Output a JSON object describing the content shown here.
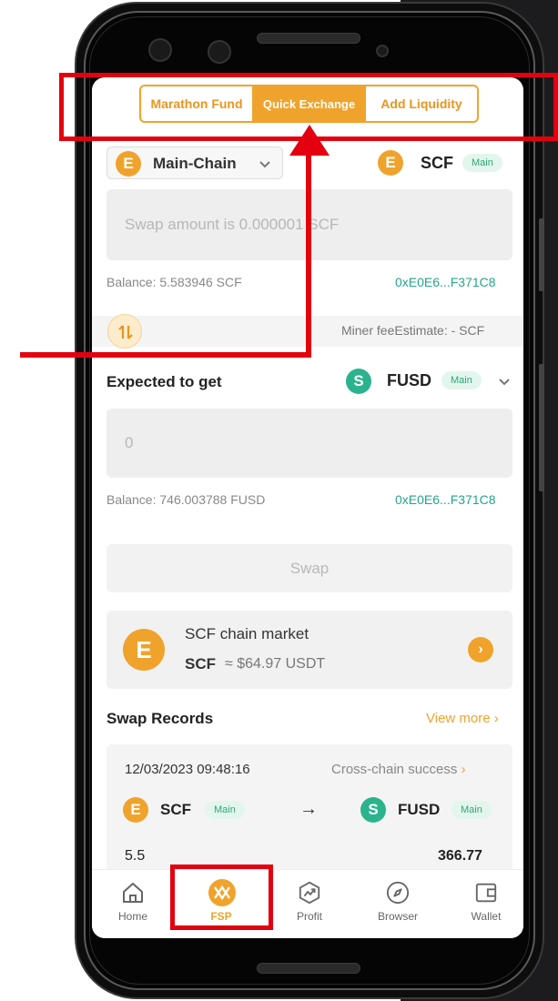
{
  "tabs": {
    "marathon_fund": "Marathon Fund",
    "quick_exchange": "Quick Exchange",
    "add_liquidity": "Add Liquidity"
  },
  "swap_from": {
    "chain_selector": "Main-Chain",
    "token": "SCF",
    "token_badge": "Main",
    "amount_placeholder": "Swap amount is 0.000001 SCF",
    "balance": "Balance: 5.583946 SCF",
    "address": "0xE0E6...F371C8",
    "miner_fee": "Miner feeEstimate: - SCF"
  },
  "swap_to": {
    "label": "Expected to get",
    "token": "FUSD",
    "token_badge": "Main",
    "amount_value": "0",
    "balance": "Balance: 746.003788 FUSD",
    "address": "0xE0E6...F371C8"
  },
  "swap_button": "Swap",
  "market": {
    "title": "SCF chain market",
    "token": "SCF",
    "price": "≈ $64.97 USDT"
  },
  "records": {
    "title": "Swap Records",
    "view_more": "View more",
    "items": [
      {
        "datetime": "12/03/2023 09:48:16",
        "status": "Cross-chain success",
        "from_token": "SCF",
        "from_badge": "Main",
        "arrow": "→",
        "to_token": "FUSD",
        "to_badge": "Main",
        "from_amount": "5.5",
        "to_amount": "366.77"
      }
    ]
  },
  "nav": {
    "items": [
      {
        "label": "Home",
        "icon": "home-icon"
      },
      {
        "label": "FSP",
        "icon": "fsp-icon",
        "active": true
      },
      {
        "label": "Profit",
        "icon": "profit-icon"
      },
      {
        "label": "Browser",
        "icon": "compass-icon"
      },
      {
        "label": "Wallet",
        "icon": "wallet-icon"
      }
    ]
  },
  "colors": {
    "accent": "#f0a32c",
    "teal": "#22a58b",
    "annotation_red": "#e3000f"
  }
}
